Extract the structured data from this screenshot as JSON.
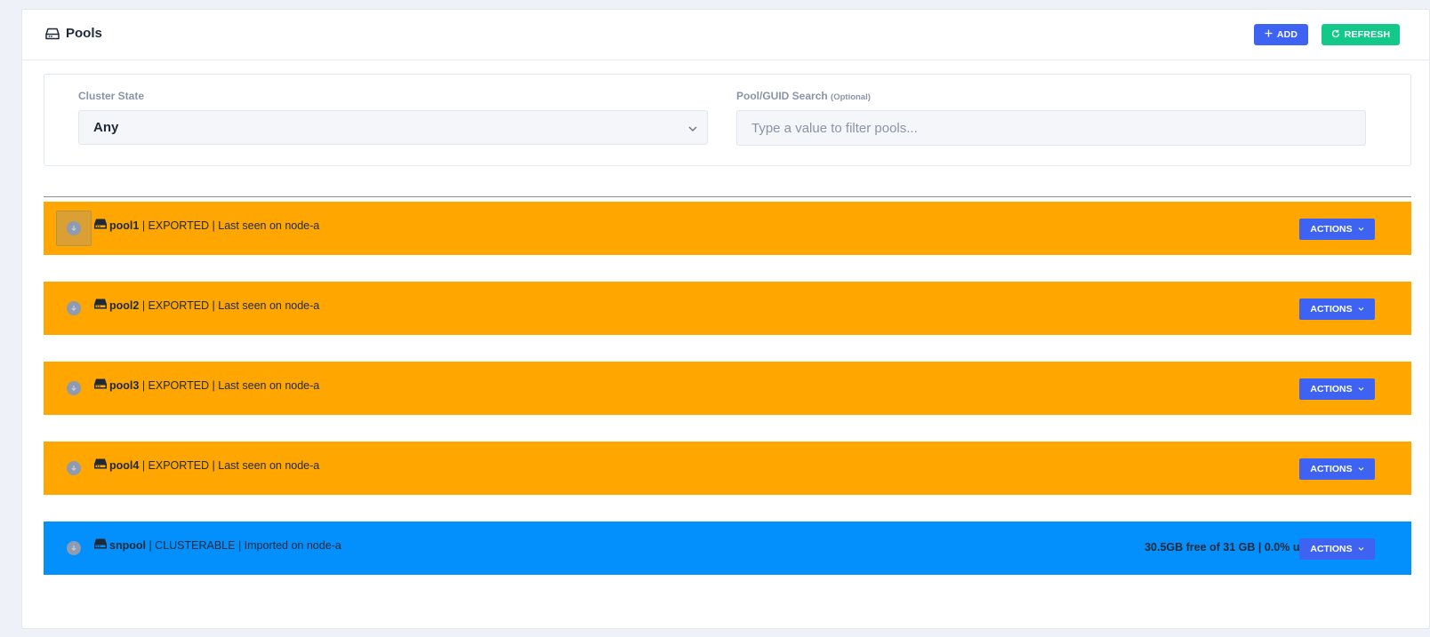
{
  "header": {
    "title": "Pools",
    "title_icon": "drive-icon",
    "add_label": "ADD",
    "refresh_label": "REFRESH",
    "add_color": "#3e63f3",
    "refresh_color": "#12c98a"
  },
  "filters": {
    "cluster_state_label": "Cluster State",
    "cluster_state_value": "Any",
    "search_label": "Pool/GUID Search",
    "search_optional": "(Optional)",
    "search_placeholder": "Type a value to filter pools...",
    "search_value": ""
  },
  "pools": [
    {
      "name": "pool1",
      "details": " | EXPORTED | Last seen on node-a",
      "usage": "",
      "actions_label": "ACTIONS",
      "status_color": "#ffa700"
    },
    {
      "name": "pool2",
      "details": " | EXPORTED | Last seen on node-a",
      "usage": "",
      "actions_label": "ACTIONS",
      "status_color": "#ffa700"
    },
    {
      "name": "pool3",
      "details": " | EXPORTED | Last seen on node-a",
      "usage": "",
      "actions_label": "ACTIONS",
      "status_color": "#ffa700"
    },
    {
      "name": "pool4",
      "details": " | EXPORTED | Last seen on node-a",
      "usage": "",
      "actions_label": "ACTIONS",
      "status_color": "#ffa700"
    },
    {
      "name": "snpool",
      "details": " | CLUSTERABLE | Imported on node-a",
      "usage": "30.5GB free of 31 GB | 0.0% used",
      "actions_label": "ACTIONS",
      "status_color": "#0390fc"
    }
  ]
}
